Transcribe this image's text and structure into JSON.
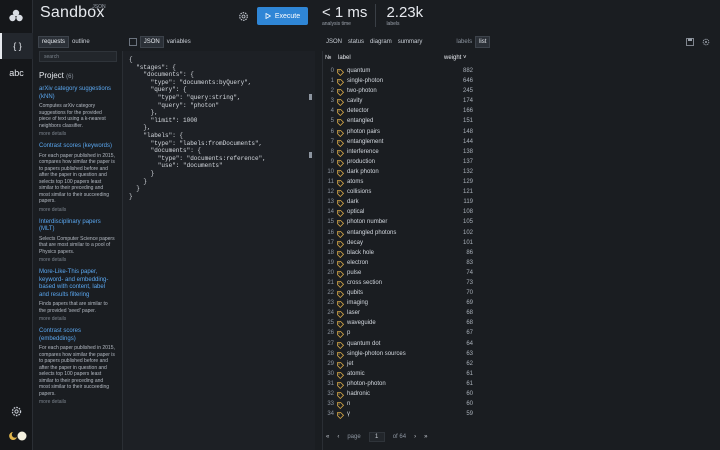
{
  "app": {
    "brand": "Sandbox",
    "brand_tag": "JSON",
    "execute_label": "Execute"
  },
  "stats": [
    {
      "value": "< 1 ms",
      "label": "analysis time"
    },
    {
      "value": "2.23k",
      "label": "labels"
    }
  ],
  "rail": {
    "items": [
      {
        "label": "{ }",
        "active": true
      },
      {
        "label": "abc",
        "active": false
      }
    ]
  },
  "left_tabs": {
    "requests": "requests",
    "outline": "outline",
    "json": "JSON",
    "variables": "variables"
  },
  "project": {
    "search_placeholder": "search",
    "title": "Project",
    "count": "(6)",
    "presets": [
      {
        "title": "arXiv category suggestions (kNN)",
        "desc": "Computes arXiv category suggestions for the provided piece of text using a k-nearest neighbors classifier.",
        "more": "more details"
      },
      {
        "title": "Contrast scores (keywords)",
        "desc": "For each paper published in 2015, compares how similar the paper is to papers published before and after the paper in question and selects top 100 papers least similar to their preceding and most similar to their succeeding papers.",
        "more": "more details"
      },
      {
        "title": "Interdisciplinary papers (MLT)",
        "desc": "Selects Computer Science papers that are most similar to a pool of Physics papers.",
        "more": "more details"
      },
      {
        "title": "More-Like-This paper, keyword- and embedding-based with content, label and results filtering",
        "desc": "Finds papers that are similar to the provided 'seed' paper.",
        "more": "more details"
      },
      {
        "title": "Contrast scores (embeddings)",
        "desc": "For each paper published in 2015, compares how similar the paper is to papers published before and after the paper in question and selects top 100 papers least similar to their preceding and most similar to their succeeding papers.",
        "more": "more details"
      }
    ]
  },
  "editor": {
    "lines": [
      "{",
      "  \"stages\": {",
      "    \"documents\": {",
      "      \"type\": \"documents:byQuery\",",
      "      \"query\": {",
      "        \"type\": \"query:string\",",
      "        \"query\": \"photon\"",
      "      },",
      "      \"limit\": 1000",
      "    },",
      "    \"labels\": {",
      "      \"type\": \"labels:fromDocuments\",",
      "      \"documents\": {",
      "        \"type\": \"documents:reference\",",
      "        \"use\": \"documents\"",
      "      }",
      "    }",
      "  }",
      "}"
    ]
  },
  "results_tabs": {
    "json": "JSON",
    "status": "status",
    "diagram": "diagram",
    "summary": "summary",
    "labels": "labels",
    "list": "list"
  },
  "results": {
    "col_no": "№",
    "col_label": "label",
    "col_weight": "weight ˅",
    "rows": [
      {
        "n": "0",
        "label": "quantum",
        "weight": "882"
      },
      {
        "n": "1",
        "label": "single-photon",
        "weight": "646"
      },
      {
        "n": "2",
        "label": "two-photon",
        "weight": "245"
      },
      {
        "n": "3",
        "label": "cavity",
        "weight": "174"
      },
      {
        "n": "4",
        "label": "detector",
        "weight": "166"
      },
      {
        "n": "5",
        "label": "entangled",
        "weight": "151"
      },
      {
        "n": "6",
        "label": "photon pairs",
        "weight": "148"
      },
      {
        "n": "7",
        "label": "entanglement",
        "weight": "144"
      },
      {
        "n": "8",
        "label": "interference",
        "weight": "138"
      },
      {
        "n": "9",
        "label": "production",
        "weight": "137"
      },
      {
        "n": "10",
        "label": "dark photon",
        "weight": "132"
      },
      {
        "n": "11",
        "label": "atoms",
        "weight": "129"
      },
      {
        "n": "12",
        "label": "collisions",
        "weight": "121"
      },
      {
        "n": "13",
        "label": "dark",
        "weight": "119"
      },
      {
        "n": "14",
        "label": "optical",
        "weight": "108"
      },
      {
        "n": "15",
        "label": "photon number",
        "weight": "105"
      },
      {
        "n": "16",
        "label": "entangled photons",
        "weight": "102"
      },
      {
        "n": "17",
        "label": "decay",
        "weight": "101"
      },
      {
        "n": "18",
        "label": "black hole",
        "weight": "86"
      },
      {
        "n": "19",
        "label": "electron",
        "weight": "83"
      },
      {
        "n": "20",
        "label": "pulse",
        "weight": "74"
      },
      {
        "n": "21",
        "label": "cross section",
        "weight": "73"
      },
      {
        "n": "22",
        "label": "qubits",
        "weight": "70"
      },
      {
        "n": "23",
        "label": "imaging",
        "weight": "69"
      },
      {
        "n": "24",
        "label": "laser",
        "weight": "68"
      },
      {
        "n": "25",
        "label": "waveguide",
        "weight": "68"
      },
      {
        "n": "26",
        "label": "p",
        "weight": "67"
      },
      {
        "n": "27",
        "label": "quantum dot",
        "weight": "64"
      },
      {
        "n": "28",
        "label": "single-photon sources",
        "weight": "63"
      },
      {
        "n": "29",
        "label": "jet",
        "weight": "62"
      },
      {
        "n": "30",
        "label": "atomic",
        "weight": "61"
      },
      {
        "n": "31",
        "label": "photon-photon",
        "weight": "61"
      },
      {
        "n": "32",
        "label": "hadronic",
        "weight": "60"
      },
      {
        "n": "33",
        "label": "n",
        "weight": "60"
      },
      {
        "n": "34",
        "label": "γ",
        "weight": "59"
      }
    ],
    "pager": {
      "page_label": "page",
      "page_value": "1",
      "of_label": "of 64"
    }
  },
  "colors": {
    "accent": "#2f86d6",
    "link": "#5aa7f0",
    "tag_icon": "#d7a94a"
  }
}
